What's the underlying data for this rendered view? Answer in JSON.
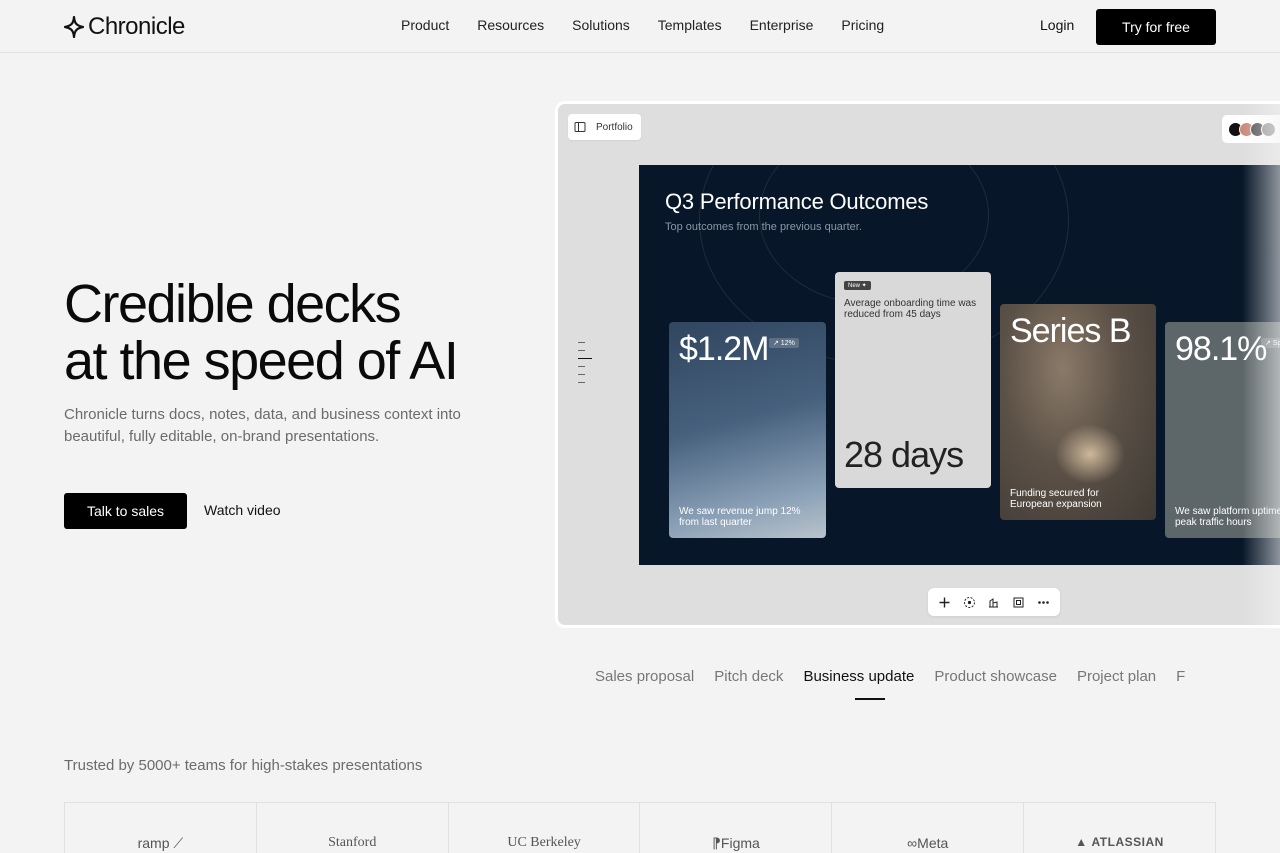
{
  "brand": {
    "name": "Chronicle"
  },
  "nav": {
    "items": [
      "Product",
      "Resources",
      "Solutions",
      "Templates",
      "Enterprise",
      "Pricing"
    ],
    "login": "Login",
    "cta": "Try for free"
  },
  "hero": {
    "title_line1": "Credible decks",
    "title_line2": "at the speed of AI",
    "subtitle": "Chronicle turns docs, notes, data, and business context into beautiful, fully editable, on-brand presentations.",
    "primary_button": "Talk to sales",
    "secondary_button": "Watch video"
  },
  "demo": {
    "workspace": "Portfolio",
    "slide": {
      "title": "Q3 Performance Outcomes",
      "subtitle": "Top outcomes from the previous quarter.",
      "cards": [
        {
          "value": "$1.2M",
          "chip": "↗ 12%",
          "caption": "We saw revenue jump 12% from last quarter"
        },
        {
          "badge": "New ✦",
          "description": "Average onboarding time was reduced from 45 days",
          "value": "28 days"
        },
        {
          "value": "Series B",
          "caption": "Funding secured for European expansion"
        },
        {
          "value": "98.1%",
          "chip": "↗ Spi",
          "caption": "We saw platform uptime i peak traffic hours"
        }
      ]
    },
    "toolbar": [
      "plus-icon",
      "sparkle-icon",
      "chart-icon",
      "frame-icon",
      "more-icon"
    ]
  },
  "tabs": {
    "items": [
      "Sales proposal",
      "Pitch deck",
      "Business update",
      "Product showcase",
      "Project plan",
      "F"
    ],
    "active_index": 2
  },
  "trusted": {
    "label": "Trusted by 5000+ teams for high-stakes presentations",
    "logos": [
      "ramp",
      "Stanford",
      "UC Berkeley",
      "Figma",
      "Meta",
      "ATLASSIAN"
    ]
  },
  "colors": {
    "slide_bg": "#071628",
    "accent": "#000000",
    "page_bg": "#f3f3f3"
  }
}
